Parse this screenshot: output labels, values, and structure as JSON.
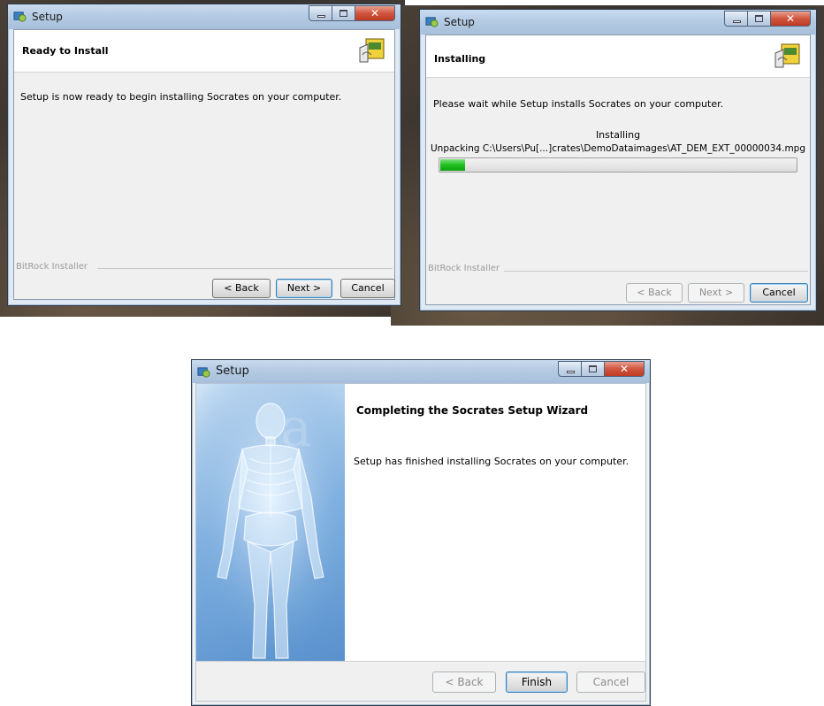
{
  "windows": [
    {
      "title": "Setup",
      "header": "Ready to Install",
      "message": "Setup is now ready to begin installing Socrates on your computer.",
      "brand": "BitRock Installer",
      "buttons": {
        "back": "< Back",
        "next": "Next >",
        "cancel": "Cancel"
      }
    },
    {
      "title": "Setup",
      "header": "Installing",
      "message": "Please wait while Setup installs Socrates on your computer.",
      "status": "Installing",
      "detail": "Unpacking C:\\Users\\Pu[...]crates\\DemoDataimages\\AT_DEM_EXT_00000034.mpg",
      "progress": 0.07,
      "brand": "BitRock Installer",
      "buttons": {
        "back": "< Back",
        "next": "Next >",
        "cancel": "Cancel"
      }
    },
    {
      "title": "Setup",
      "header": "Completing the Socrates Setup Wizard",
      "message": "Setup has finished installing Socrates on your computer.",
      "buttons": {
        "back": "< Back",
        "finish": "Finish",
        "cancel": "Cancel"
      }
    }
  ],
  "colors": {
    "progress": "#20c020",
    "side_panel": "#6fa3d8"
  },
  "icons": {
    "app": "setup-app-icon",
    "header": "installer-box-icon",
    "side": "human-skeleton-image"
  }
}
